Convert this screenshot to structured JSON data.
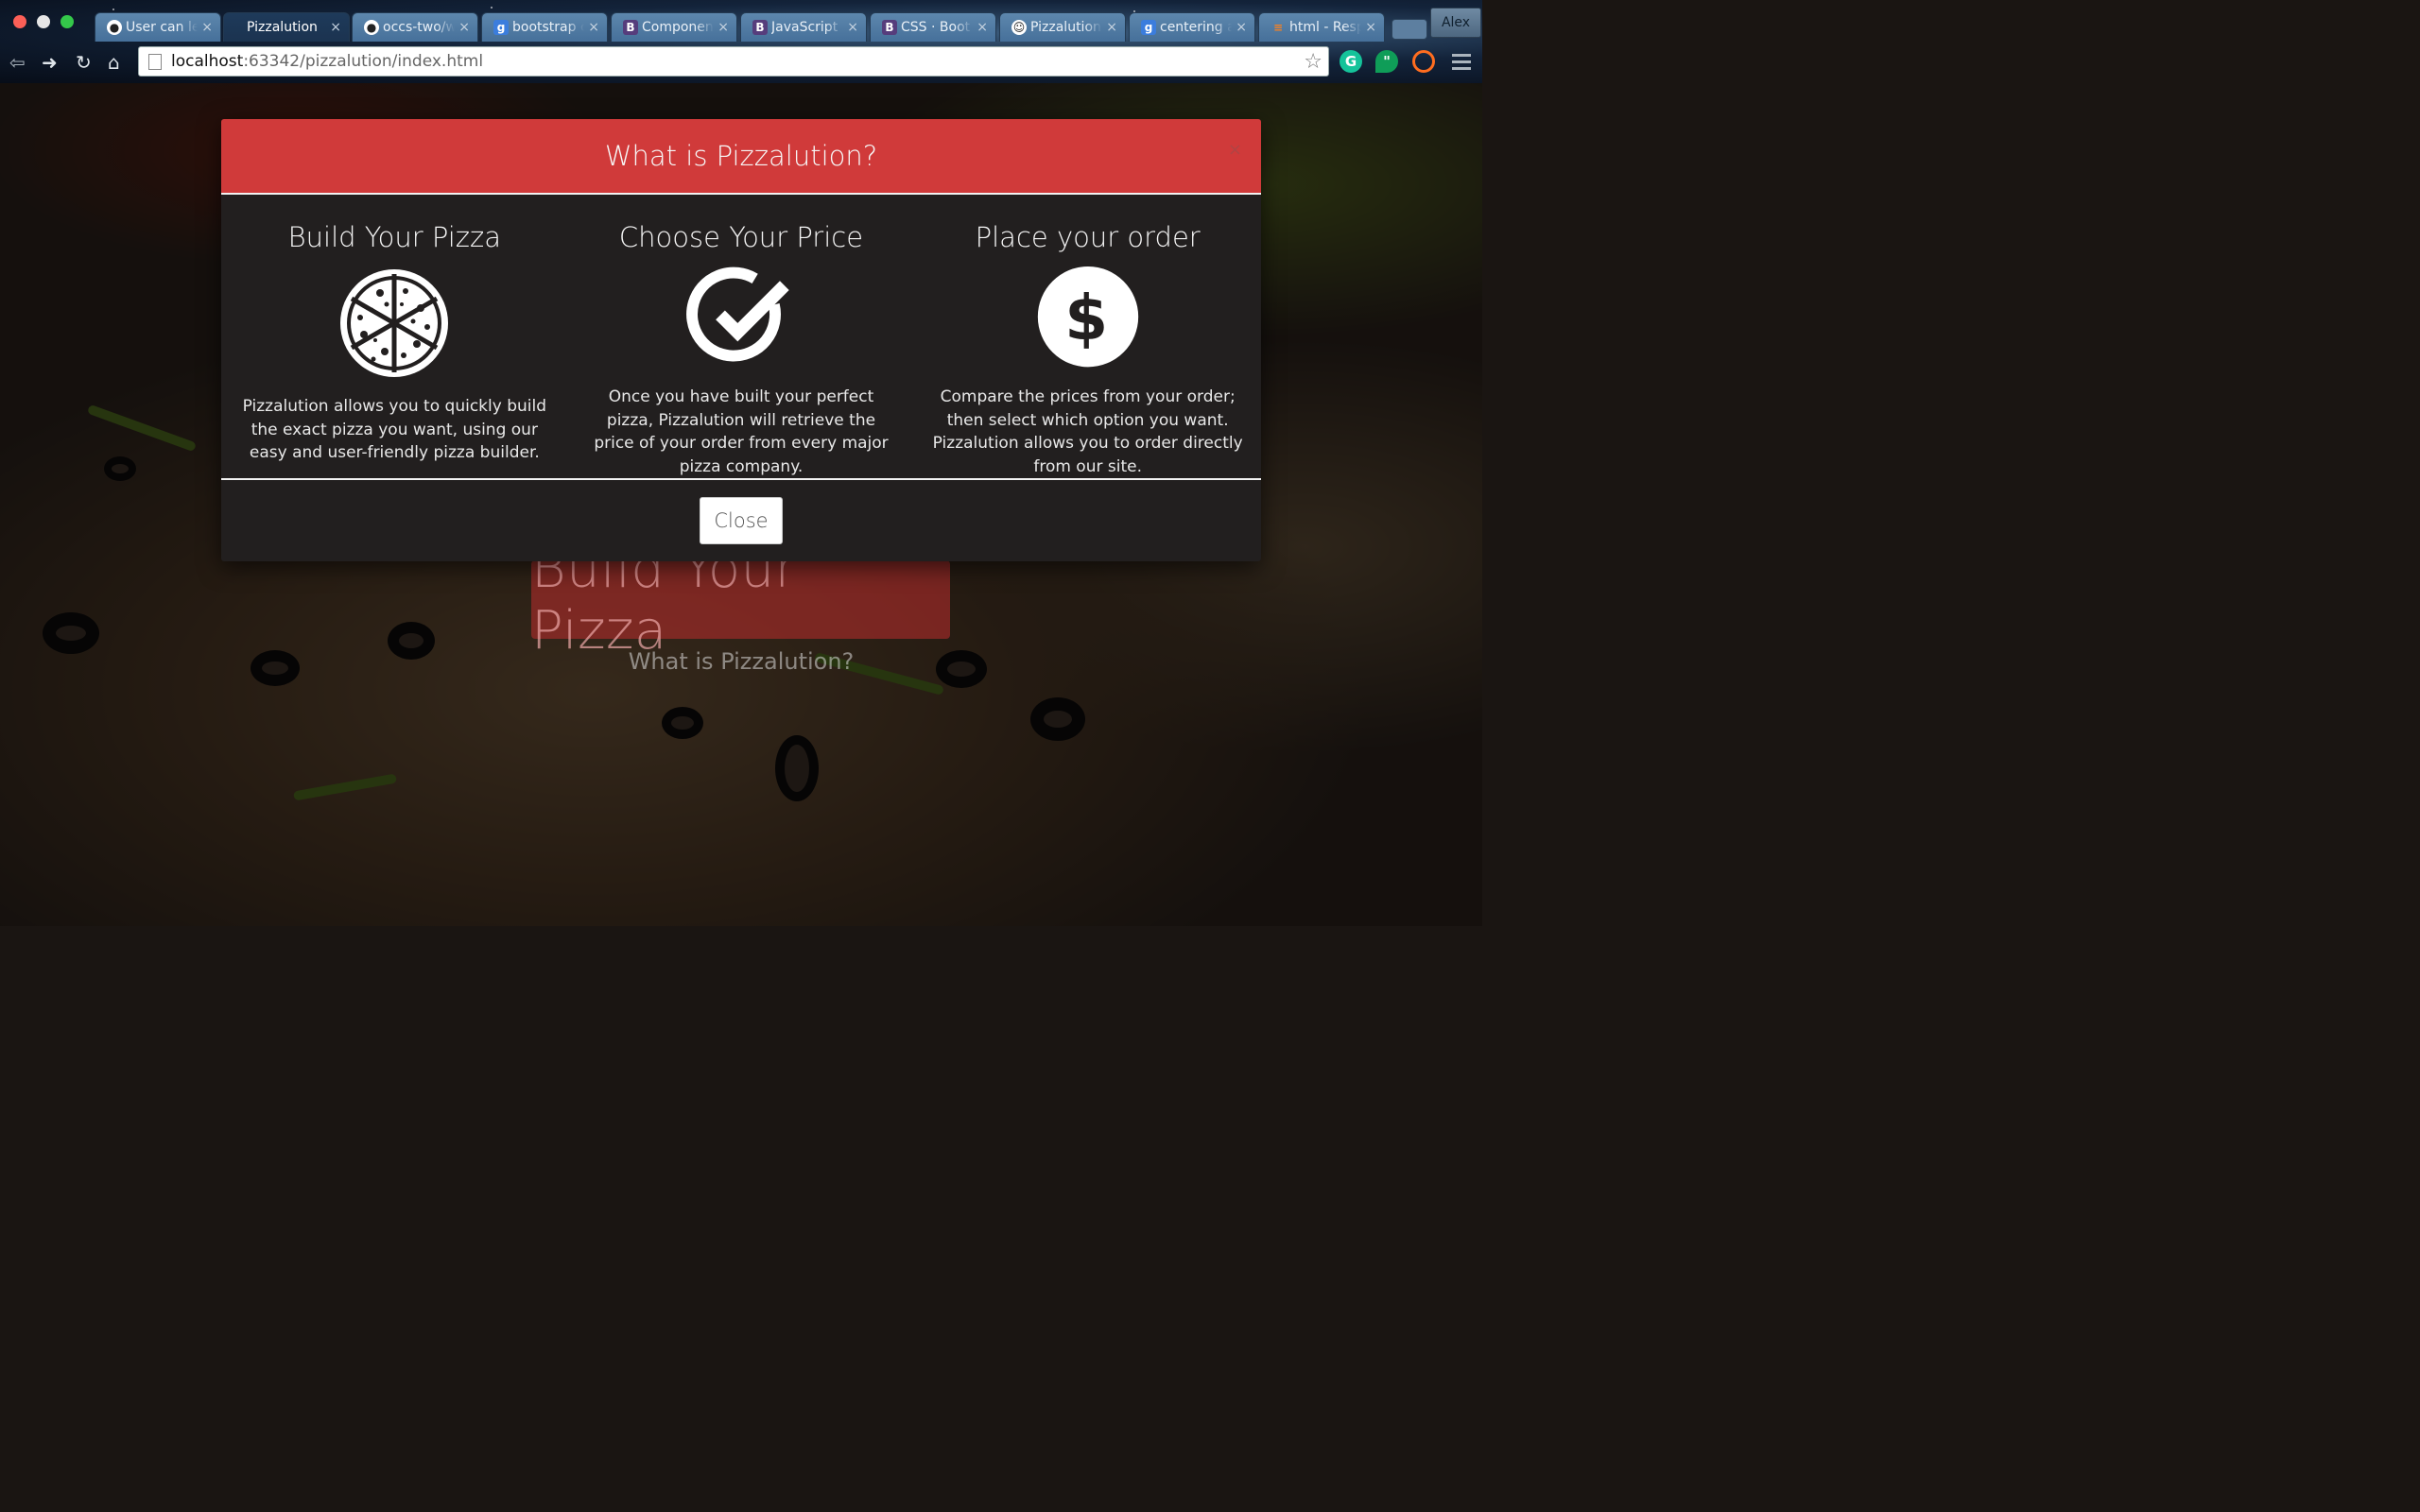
{
  "browser": {
    "tabs": [
      {
        "label": "User can le",
        "favicon": "github-icon",
        "active": false
      },
      {
        "label": "Pizzalution",
        "favicon": "none",
        "active": true
      },
      {
        "label": "occs-two/w",
        "favicon": "github-icon",
        "active": false
      },
      {
        "label": "bootstrap c",
        "favicon": "google-icon",
        "active": false
      },
      {
        "label": "Component",
        "favicon": "bootstrap-icon",
        "active": false
      },
      {
        "label": "JavaScript",
        "favicon": "bootstrap-icon",
        "active": false
      },
      {
        "label": "CSS · Boot",
        "favicon": "bootstrap-icon",
        "active": false
      },
      {
        "label": "Pizzalution",
        "favicon": "smiley-icon",
        "active": false
      },
      {
        "label": "centering a",
        "favicon": "google-icon",
        "active": false
      },
      {
        "label": "html - Resp",
        "favicon": "stackoverflow-icon",
        "active": false
      }
    ],
    "profile_name": "Alex",
    "url_host": "localhost",
    "url_path": ":63342/pizzalution/index.html"
  },
  "hero": {
    "button_label": "Build Your Pizza",
    "link_label": "What is Pizzalution?"
  },
  "modal": {
    "title": "What is Pizzalution?",
    "close_x": "×",
    "columns": [
      {
        "title": "Build Your Pizza",
        "icon": "pizza-icon",
        "text": "Pizzalution allows you to quickly build the exact pizza you want, using our easy and user-friendly pizza builder."
      },
      {
        "title": "Choose Your Price",
        "icon": "checkmark-circle-icon",
        "text": "Once you have built your perfect pizza, Pizzalution will retrieve the price of your order from every major pizza company."
      },
      {
        "title": "Place your order",
        "icon": "dollar-circle-icon",
        "text": "Compare the prices from your order; then select which option you want. Pizzalution allows you to order directly from our site."
      }
    ],
    "close_button_label": "Close"
  },
  "colors": {
    "modal_header": "#d03a3a",
    "modal_body": "#221f1f",
    "hero_button": "#be2d2d"
  }
}
